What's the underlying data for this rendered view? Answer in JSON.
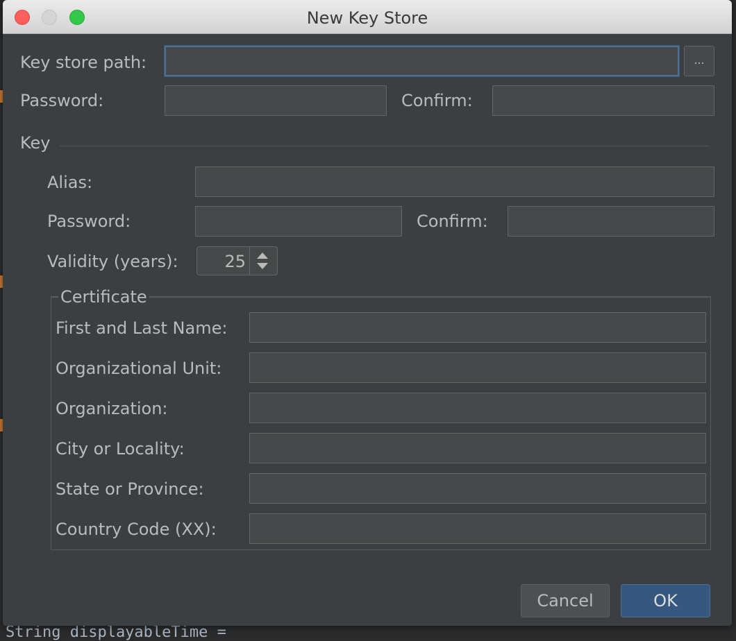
{
  "window": {
    "title": "New Key Store"
  },
  "keystore": {
    "path_label": "Key store path:",
    "path_value": "",
    "browse_label": "...",
    "password_label": "Password:",
    "password_value": "",
    "confirm_label": "Confirm:",
    "confirm_value": ""
  },
  "key": {
    "section_label": "Key",
    "alias_label": "Alias:",
    "alias_value": "",
    "password_label": "Password:",
    "password_value": "",
    "confirm_label": "Confirm:",
    "confirm_value": "",
    "validity_label": "Validity (years):",
    "validity_value": "25"
  },
  "certificate": {
    "title": "Certificate",
    "fields": [
      {
        "label": "First and Last Name:",
        "value": ""
      },
      {
        "label": "Organizational Unit:",
        "value": ""
      },
      {
        "label": "Organization:",
        "value": ""
      },
      {
        "label": "City or Locality:",
        "value": ""
      },
      {
        "label": "State or Province:",
        "value": ""
      },
      {
        "label": "Country Code (XX):",
        "value": ""
      }
    ]
  },
  "buttons": {
    "cancel": "Cancel",
    "ok": "OK"
  },
  "background": {
    "code_line": "String displayableTime ="
  },
  "colors": {
    "dialog_bg": "#3c3f41",
    "field_bg": "#45494a",
    "focus_border": "#4e7196",
    "ok_button": "#365880",
    "text": "#bbbbbb"
  }
}
